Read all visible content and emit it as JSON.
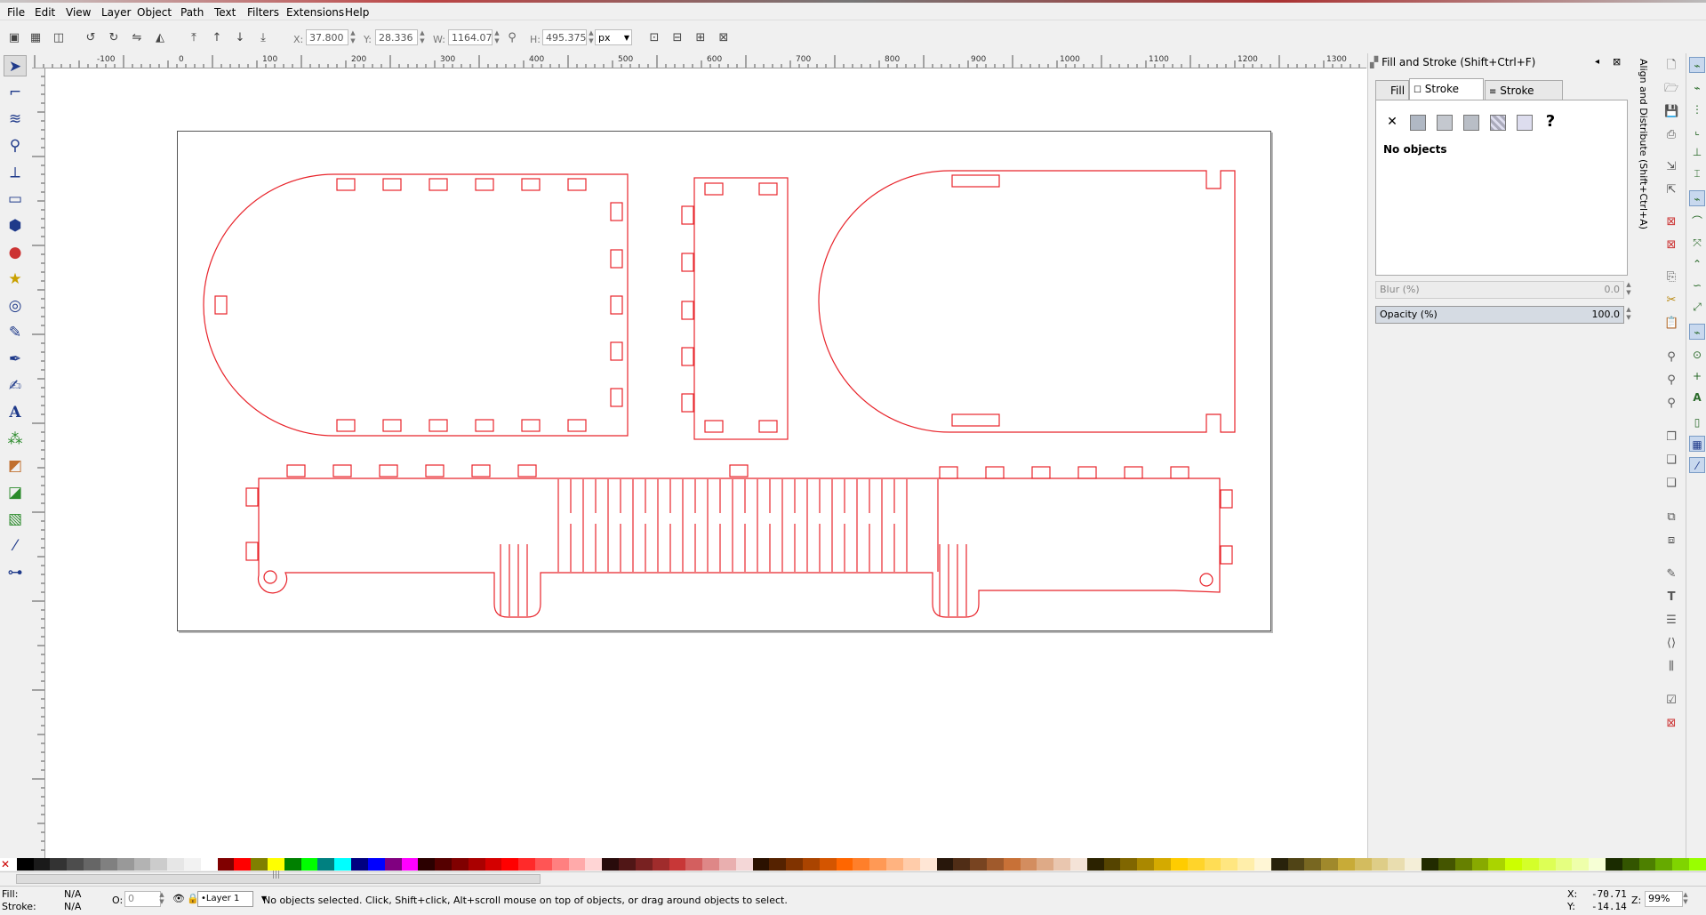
{
  "menu": [
    "File",
    "Edit",
    "View",
    "Layer",
    "Object",
    "Path",
    "Text",
    "Filters",
    "Extensions",
    "Help"
  ],
  "toolbar": {
    "x_label": "X:",
    "x_value": "37.800",
    "y_label": "Y:",
    "y_value": "28.336",
    "w_label": "W:",
    "w_value": "1164.07",
    "h_label": "H:",
    "h_value": "495.375",
    "unit": "px"
  },
  "ruler_top": [
    "-100",
    "0",
    "100",
    "200",
    "300",
    "400",
    "500",
    "600",
    "700",
    "800",
    "900",
    "1000",
    "1100",
    "1200",
    "1300"
  ],
  "ruler_left": [
    "0",
    "100",
    "200",
    "300",
    "400",
    "500",
    "600",
    "700",
    "800",
    "900"
  ],
  "dock": {
    "title": "Fill and Stroke (Shift+Ctrl+F)",
    "tabs": {
      "fill": "Fill",
      "stroke_paint": "Stroke paint",
      "stroke_style": "Stroke style"
    },
    "no_paint_symbol": "✕",
    "unknown_symbol": "?",
    "status": "No objects",
    "blur_label": "Blur (%)",
    "blur_value": "0.0",
    "opacity_label": "Opacity (%)",
    "opacity_value": "100.0",
    "vertical_tab": "Align and Distribute (Shift+Ctrl+A)"
  },
  "status": {
    "fill_label": "Fill:",
    "fill_value": "N/A",
    "stroke_label": "Stroke:",
    "stroke_value": "N/A",
    "opacity_label": "O:",
    "opacity_value": "0",
    "layer": "•Layer 1",
    "message": "No objects selected. Click, Shift+click, Alt+scroll mouse on top of objects, or drag around objects to select.",
    "x_label": "X:",
    "x_value": "-70.71",
    "y_label": "Y:",
    "y_value": "-14.14",
    "zoom_label": "Z:",
    "zoom_value": "99%"
  },
  "colors": {
    "stroke": "#e8242b",
    "accent": "#7a9cc6"
  }
}
